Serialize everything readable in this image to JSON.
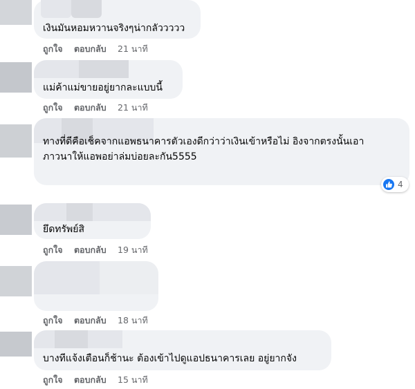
{
  "comments": [
    {
      "text": "เงินมันหอมหวานจริงๆน่ากลัววววว",
      "like": "ถูกใจ",
      "reply": "ตอบกลับ",
      "time": "21 นาที"
    },
    {
      "text": "แม่ค้าแม่ขายอยู่ยากละแบบนี้",
      "like": "ถูกใจ",
      "reply": "ตอบกลับ",
      "time": "21 นาที"
    },
    {
      "text_line1": "ทางที่ดีคือเช็คจากแอพธนาคารตัวเองดีกว่าว่าเงินเข้าหรือไม่ อิงจากตรงนั้นเอา",
      "text_line2": "ภาวนาให้แอพอย่าล่มบ่อยละกัน5555",
      "reaction_icon": "thumbs-up-icon",
      "reaction_count": "4"
    },
    {
      "text": "ยึดทรัพย์สิ",
      "like": "ถูกใจ",
      "reply": "ตอบกลับ",
      "time": "19 นาที"
    },
    {
      "like": "ถูกใจ",
      "reply": "ตอบกลับ",
      "time": "18 นาที"
    },
    {
      "text": "บางทีแจ้งเตือนก็ช้านะ ต้องเข้าไปดูแอปธนาคารเลย อยู่ยากจัง",
      "like": "ถูกใจ",
      "reply": "ตอบกลับ",
      "time": "15 นาที"
    }
  ],
  "colors": {
    "bubble": "#f0f2f5",
    "meta_text": "#65676b",
    "like_blue": "#1877f2"
  }
}
